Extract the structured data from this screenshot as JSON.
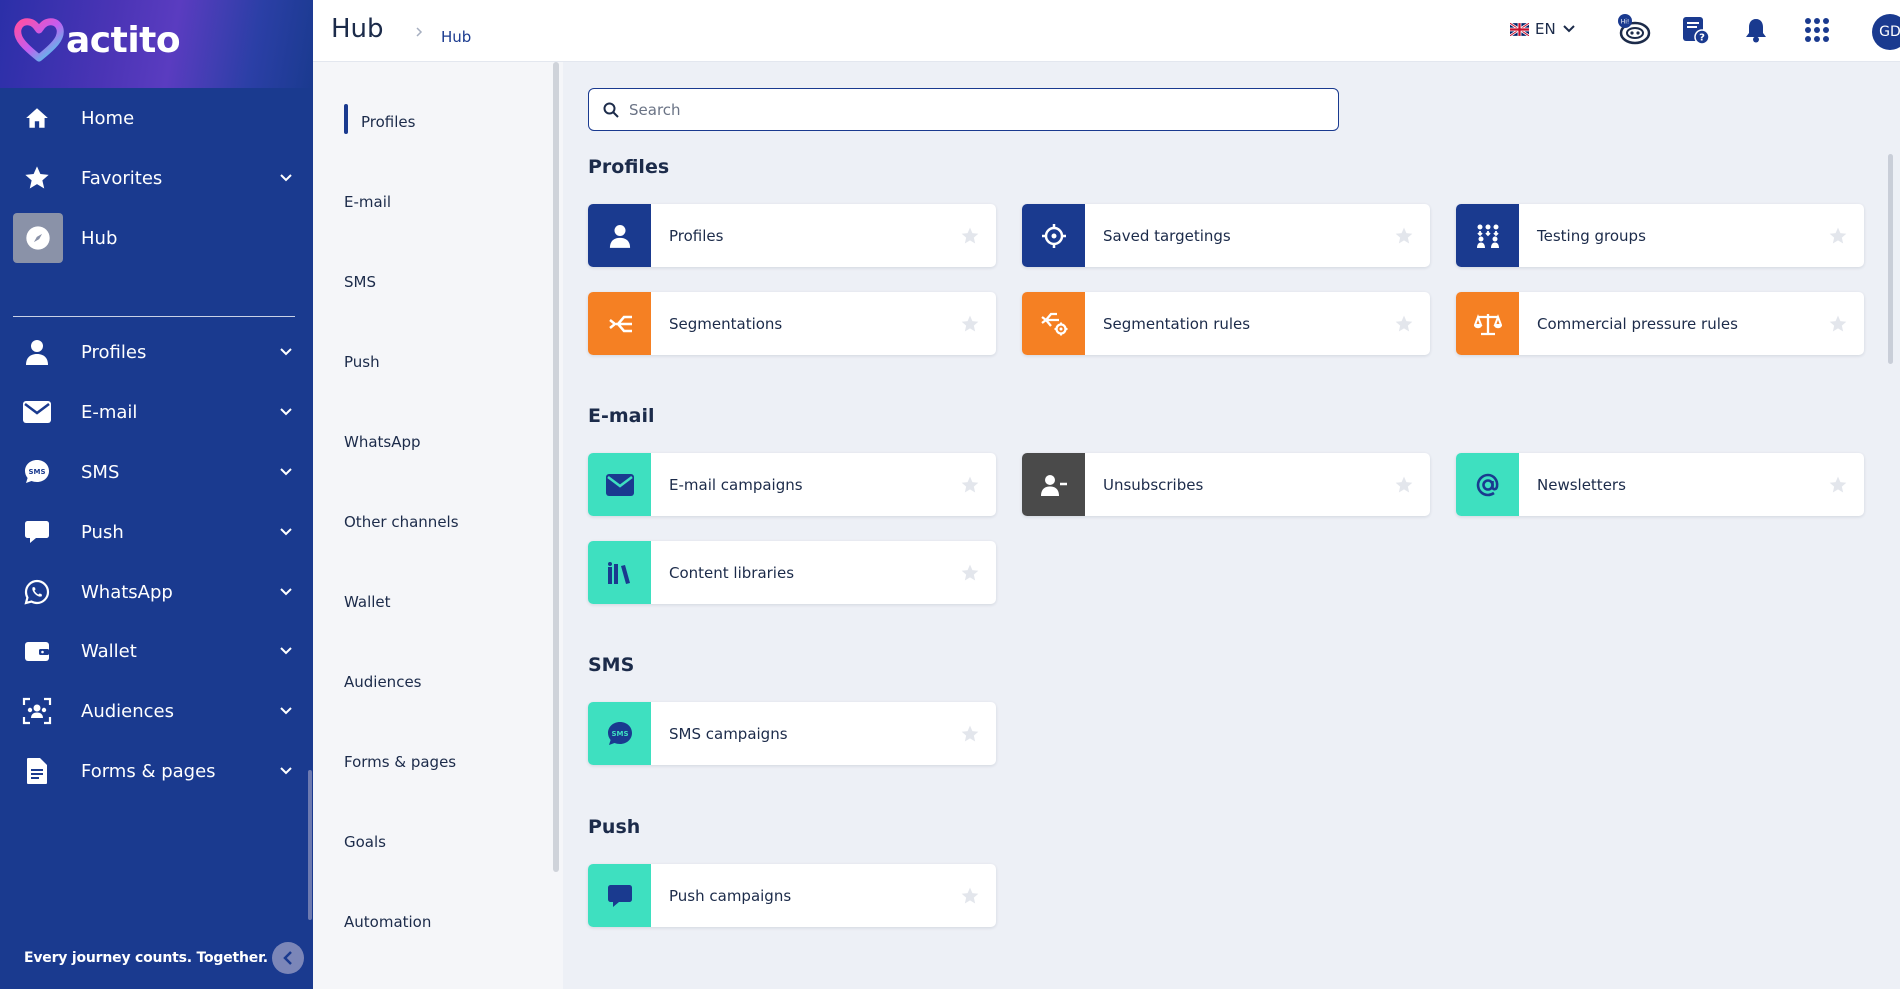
{
  "app": {
    "name": "actito",
    "tagline": "Every journey counts. Together."
  },
  "colors": {
    "navy": "#1a3a8f",
    "orange": "#f58023",
    "teal": "#3ee0c0",
    "dark": "#4a4a4a"
  },
  "sidebar": {
    "items": [
      {
        "label": "Home",
        "icon": "home-icon"
      },
      {
        "label": "Favorites",
        "icon": "star-icon"
      },
      {
        "label": "Hub",
        "icon": "compass-icon"
      },
      {
        "label": "Profiles",
        "icon": "person-icon"
      },
      {
        "label": "E-mail",
        "icon": "envelope-icon"
      },
      {
        "label": "SMS",
        "icon": "sms-bubble-icon"
      },
      {
        "label": "Push",
        "icon": "chat-bubble-icon"
      },
      {
        "label": "WhatsApp",
        "icon": "whatsapp-icon"
      },
      {
        "label": "Wallet",
        "icon": "wallet-icon"
      },
      {
        "label": "Audiences",
        "icon": "audience-icon"
      },
      {
        "label": "Forms & pages",
        "icon": "document-icon"
      }
    ]
  },
  "header": {
    "title": "Hub",
    "breadcrumb": "Hub",
    "language": "EN",
    "avatar_initials": "GD",
    "assistant_badge": "Hi!"
  },
  "subnav": {
    "items": [
      "Profiles",
      "E-mail",
      "SMS",
      "Push",
      "WhatsApp",
      "Other channels",
      "Wallet",
      "Audiences",
      "Forms & pages",
      "Goals",
      "Automation"
    ]
  },
  "search": {
    "placeholder": "Search"
  },
  "sections": [
    {
      "title": "Profiles",
      "cards": [
        {
          "label": "Profiles",
          "icon": "person-icon",
          "color": "navy"
        },
        {
          "label": "Saved targetings",
          "icon": "target-icon",
          "color": "navy"
        },
        {
          "label": "Testing groups",
          "icon": "group-icon",
          "color": "navy"
        },
        {
          "label": "Segmentations",
          "icon": "merge-arrows-icon",
          "color": "orange"
        },
        {
          "label": "Segmentation rules",
          "icon": "segment-rule-gear-icon",
          "color": "orange"
        },
        {
          "label": "Commercial pressure rules",
          "icon": "scale-icon",
          "color": "orange"
        }
      ]
    },
    {
      "title": "E-mail",
      "cards": [
        {
          "label": "E-mail campaigns",
          "icon": "envelope-icon",
          "color": "teal"
        },
        {
          "label": "Unsubscribes",
          "icon": "person-minus-icon",
          "color": "dark"
        },
        {
          "label": "Newsletters",
          "icon": "at-sign-icon",
          "color": "teal"
        },
        {
          "label": "Content libraries",
          "icon": "library-books-icon",
          "color": "teal"
        }
      ]
    },
    {
      "title": "SMS",
      "cards": [
        {
          "label": "SMS campaigns",
          "icon": "sms-bubble-icon",
          "color": "teal"
        }
      ]
    },
    {
      "title": "Push",
      "cards": [
        {
          "label": "Push campaigns",
          "icon": "chat-bubble-icon",
          "color": "teal"
        }
      ]
    }
  ]
}
